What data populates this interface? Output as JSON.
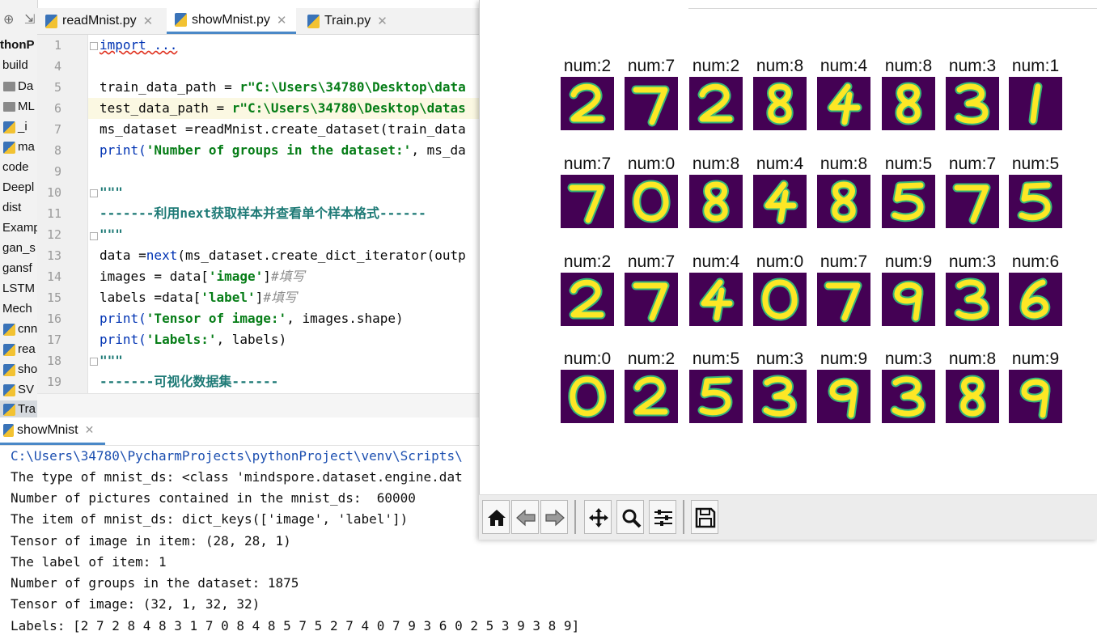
{
  "project": {
    "title": "thonP",
    "items": [
      "build",
      "Da",
      "ML",
      "_i",
      "ma",
      "code",
      "Deepl",
      "dist",
      "Examp",
      "gan_s",
      "gansf",
      "LSTM",
      "Mech",
      "cnn",
      "rea",
      "sho",
      "SV",
      "Tra"
    ]
  },
  "tabs": [
    {
      "label": "readMnist.py"
    },
    {
      "label": "showMnist.py"
    },
    {
      "label": "Train.py"
    }
  ],
  "editor": {
    "line_numbers": [
      "1",
      "4",
      "5",
      "6",
      "7",
      "8",
      "9",
      "10",
      "11",
      "12",
      "13",
      "14",
      "15",
      "16",
      "17",
      "18",
      "19"
    ],
    "l1": "import ...",
    "l5a": "train_data_path = ",
    "l5b": "r\"C:\\Users\\34780\\Desktop\\data",
    "l6a": "test_data_path = ",
    "l6b": "r\"C:\\Users\\34780\\Desktop\\datas",
    "l7a": "ms_dataset =",
    "l7b": "readMnist.create_dataset(train_data",
    "l8a": "print(",
    "l8b": "'Number of groups in the dataset:'",
    "l8c": ", ms_da",
    "l10": "\"\"\"",
    "l11": "-------利用next获取样本并查看单个样本格式------",
    "l12": "\"\"\"",
    "l13a": "data =",
    "l13b": "next",
    "l13c": "(ms_dataset.create_dict_iterator(outp",
    "l14a": "images = data[",
    "l14b": "'image'",
    "l14c": "]",
    "l14d": "#填写",
    "l15a": "labels =data[",
    "l15b": "'label'",
    "l15c": "]",
    "l15d": "#填写",
    "l16a": "print(",
    "l16b": "'Tensor of image:'",
    "l16c": ", images.shape)",
    "l17a": "print(",
    "l17b": "'Labels:'",
    "l17c": ", labels)",
    "l18": "\"\"\"",
    "l19": "-------可视化数据集------"
  },
  "run": {
    "tab_label": "showMnist",
    "lines": [
      "C:\\Users\\34780\\PycharmProjects\\pythonProject\\venv\\Scripts\\",
      "The type of mnist_ds: <class 'mindspore.dataset.engine.dat",
      "Number of pictures contained in the mnist_ds:  60000",
      "The item of mnist_ds: dict_keys(['image', 'label'])",
      "Tensor of image in item: (28, 28, 1)",
      "The label of item: 1",
      "Number of groups in the dataset: 1875",
      "Tensor of image: (32, 1, 32, 32)",
      "Labels: [2 7 2 8 4 8 3 1 7 0 8 4 8 5 7 5 2 7 4 0 7 9 3 6 0 2 5 3 9 3 8 9]"
    ]
  },
  "figure": {
    "labels": [
      [
        "num:2",
        "num:7",
        "num:2",
        "num:8",
        "num:4",
        "num:8",
        "num:3",
        "num:1"
      ],
      [
        "num:7",
        "num:0",
        "num:8",
        "num:4",
        "num:8",
        "num:5",
        "num:7",
        "num:5"
      ],
      [
        "num:2",
        "num:7",
        "num:4",
        "num:0",
        "num:7",
        "num:9",
        "num:3",
        "num:6"
      ],
      [
        "num:0",
        "num:2",
        "num:5",
        "num:3",
        "num:9",
        "num:3",
        "num:8",
        "num:9"
      ]
    ],
    "digits": [
      [
        "2",
        "7",
        "2",
        "8",
        "4",
        "8",
        "3",
        "1"
      ],
      [
        "7",
        "0",
        "8",
        "4",
        "8",
        "5",
        "7",
        "5"
      ],
      [
        "2",
        "7",
        "4",
        "0",
        "7",
        "9",
        "3",
        "6"
      ],
      [
        "0",
        "2",
        "5",
        "3",
        "9",
        "3",
        "8",
        "9"
      ]
    ],
    "colors": {
      "background": "#440154",
      "digit": "#fde725",
      "edge": "#35b779"
    }
  },
  "toolbar": {
    "icons": [
      "home-icon",
      "back-arrow-icon",
      "forward-arrow-icon",
      "pan-icon",
      "zoom-icon",
      "subplots-icon",
      "save-icon"
    ]
  }
}
